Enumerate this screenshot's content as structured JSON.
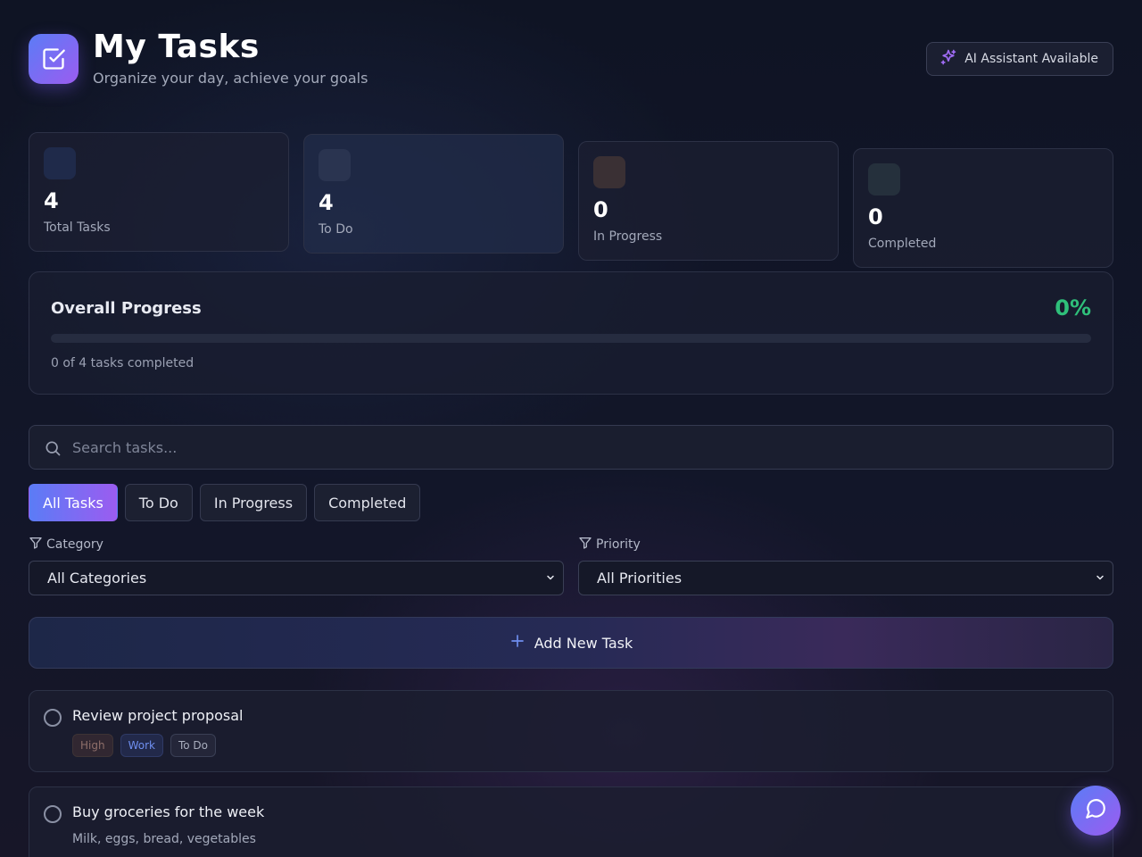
{
  "header": {
    "title": "My Tasks",
    "subtitle": "Organize your day, achieve your goals",
    "logo_icon": "checkbox-icon",
    "ai_badge": "AI Assistant Available",
    "ai_icon": "sparkles-icon"
  },
  "stats": [
    {
      "value": "4",
      "label": "Total Tasks",
      "color": "#1f2a4a"
    },
    {
      "value": "4",
      "label": "To Do",
      "color": "#2a3450"
    },
    {
      "value": "0",
      "label": "In Progress",
      "color": "#3a3034"
    },
    {
      "value": "0",
      "label": "Completed",
      "color": "#25303c"
    }
  ],
  "progress": {
    "title": "Overall Progress",
    "percent_label": "0%",
    "percent": 0,
    "summary": "0 of 4 tasks completed",
    "color": "#2fbf7a"
  },
  "search": {
    "placeholder": "Search tasks...",
    "icon": "search-icon"
  },
  "filters": {
    "tabs": [
      "All Tasks",
      "To Do",
      "In Progress",
      "Completed"
    ],
    "active": "All Tasks"
  },
  "category": {
    "label": "Category",
    "selected": "All Categories",
    "icon": "filter-icon"
  },
  "priority": {
    "label": "Priority",
    "selected": "All Priorities",
    "icon": "filter-icon"
  },
  "add_task": {
    "label": "Add New Task",
    "icon": "plus-icon"
  },
  "tasks": [
    {
      "title": "Review project proposal",
      "tags": [
        "High",
        "Work",
        "To Do"
      ]
    },
    {
      "title": "Buy groceries for the week",
      "description": "Milk, eggs, bread, vegetables"
    }
  ],
  "chat_button": {
    "icon": "chat-bubble-icon"
  },
  "colors": {
    "accent_start": "#5b7cf6",
    "accent_end": "#9b5cf0",
    "success": "#2fbf7a"
  }
}
